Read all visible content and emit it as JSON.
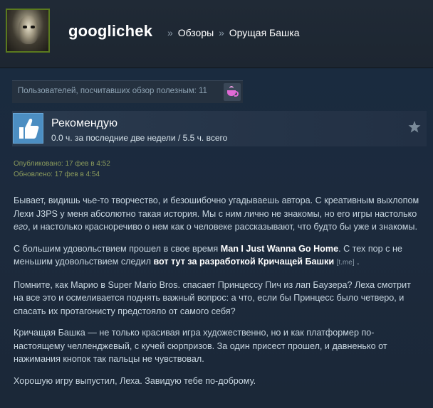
{
  "header": {
    "user_name": "googlichek",
    "sep1": "»",
    "crumb_reviews": "Обзоры",
    "sep2": "»",
    "crumb_game": "Орущая Башка"
  },
  "helpful": {
    "text": "Пользователей, посчитавших обзор полезным: 11",
    "award_icon": "coffee-cup-icon"
  },
  "vote": {
    "title": "Рекомендую",
    "hours": "0.0 ч. за последние две недели / 5.5 ч. всего",
    "thumb_icon": "thumbs-up-icon",
    "star_icon": "star-icon"
  },
  "dates": {
    "published": "Опубликовано: 17 фев в 4:52",
    "updated": "Обновлено: 17 фев в 4:54"
  },
  "review": {
    "p1_a": "Бывает, видишь чье-то творчество, и безошибочно угадываешь автора. С креативным выхлопом Лехи J3PS у меня абсолютно такая история. Мы с ним лично не знакомы, но его игры настолько ",
    "p1_em": "его",
    "p1_b": ", и настолько красноречиво о нем как о человеке рассказывают, что будто бы уже и знакомы.",
    "p2_a": "С большим удовольствием прошел в свое время ",
    "p2_link1": "Man I Just Wanna Go Home",
    "p2_b": ". С тех пор с не меньшим удовольствием следил ",
    "p2_link2": "вот тут за разработкой Кричащей Башки",
    "p2_tme": "[t.me]",
    "p2_c": " .",
    "p3": "Помните, как Марио в Super Mario Bros. спасает Принцессу Пич из лап Баузера? Леха смотрит на все это и осмеливается поднять важный вопрос: а что, если бы Принцесс было четверо, и спасать их протагонисту предстояло от самого себя?",
    "p4": "Кричащая Башка — не только красивая игра художественно, но и как платформер по-настоящему челленджевый, с кучей сюрпризов. За один присест прошел, и давненько от нажимания кнопок так пальцы не чувствовал.",
    "p5": "Хорошую игру выпустил, Леха. Завидую тебе по-доброму."
  },
  "colors": {
    "background": "#1b2838",
    "thumb_bg": "#4c8ec2",
    "award": "#e06ad6",
    "dates": "#8b9a5c"
  }
}
